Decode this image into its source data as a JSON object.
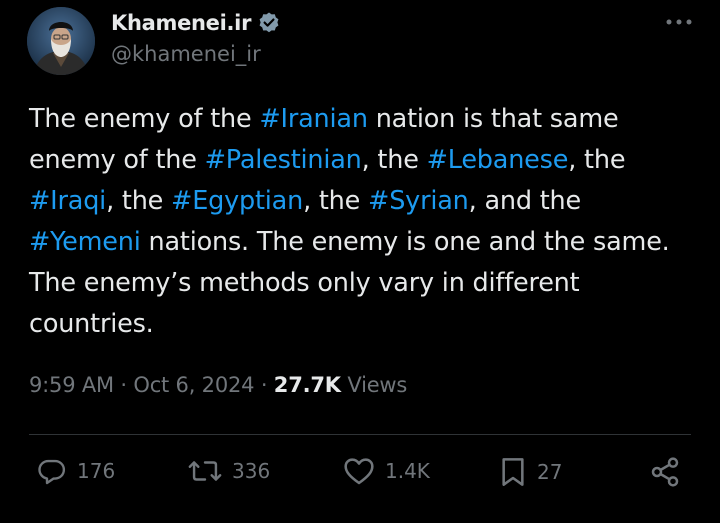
{
  "author": {
    "display_name": "Khamenei.ir",
    "handle": "@khamenei_ir",
    "verified": true
  },
  "tweet": {
    "lines": [
      [
        {
          "text": "The enemy of the ",
          "hashtag": false
        },
        {
          "text": "#Iranian",
          "hashtag": true
        },
        {
          "text": " nation is that same",
          "hashtag": false
        }
      ],
      [
        {
          "text": "enemy of the ",
          "hashtag": false
        },
        {
          "text": "#Palestinian",
          "hashtag": true
        },
        {
          "text": ", the ",
          "hashtag": false
        },
        {
          "text": "#Lebanese",
          "hashtag": true
        },
        {
          "text": ", the",
          "hashtag": false
        }
      ],
      [
        {
          "text": "#Iraqi",
          "hashtag": true
        },
        {
          "text": ", the ",
          "hashtag": false
        },
        {
          "text": "#Egyptian",
          "hashtag": true
        },
        {
          "text": ", the ",
          "hashtag": false
        },
        {
          "text": "#Syrian",
          "hashtag": true
        },
        {
          "text": ", and the",
          "hashtag": false
        }
      ],
      [
        {
          "text": "#Yemeni",
          "hashtag": true
        },
        {
          "text": " nations. The enemy is one and the same.",
          "hashtag": false
        }
      ],
      [
        {
          "text": "The enemy’s methods only vary in different",
          "hashtag": false
        }
      ],
      [
        {
          "text": "countries.",
          "hashtag": false
        }
      ]
    ]
  },
  "meta": {
    "time": "9:59 AM",
    "separator": "·",
    "date": "Oct 6, 2024",
    "views_count": "27.7K",
    "views_label": "Views"
  },
  "actions": {
    "replies": "176",
    "reposts": "336",
    "likes": "1.4K",
    "bookmarks": "27"
  },
  "icons": {
    "more": "more-horizontal-icon",
    "verified": "verified-badge-icon",
    "reply": "reply-icon",
    "repost": "repost-icon",
    "like": "heart-icon",
    "bookmark": "bookmark-icon",
    "share": "share-icon"
  },
  "colors": {
    "background": "#000000",
    "text": "#e7e9ea",
    "secondary": "#71767b",
    "accent": "#1d9bf0",
    "divider": "#2f3336"
  }
}
